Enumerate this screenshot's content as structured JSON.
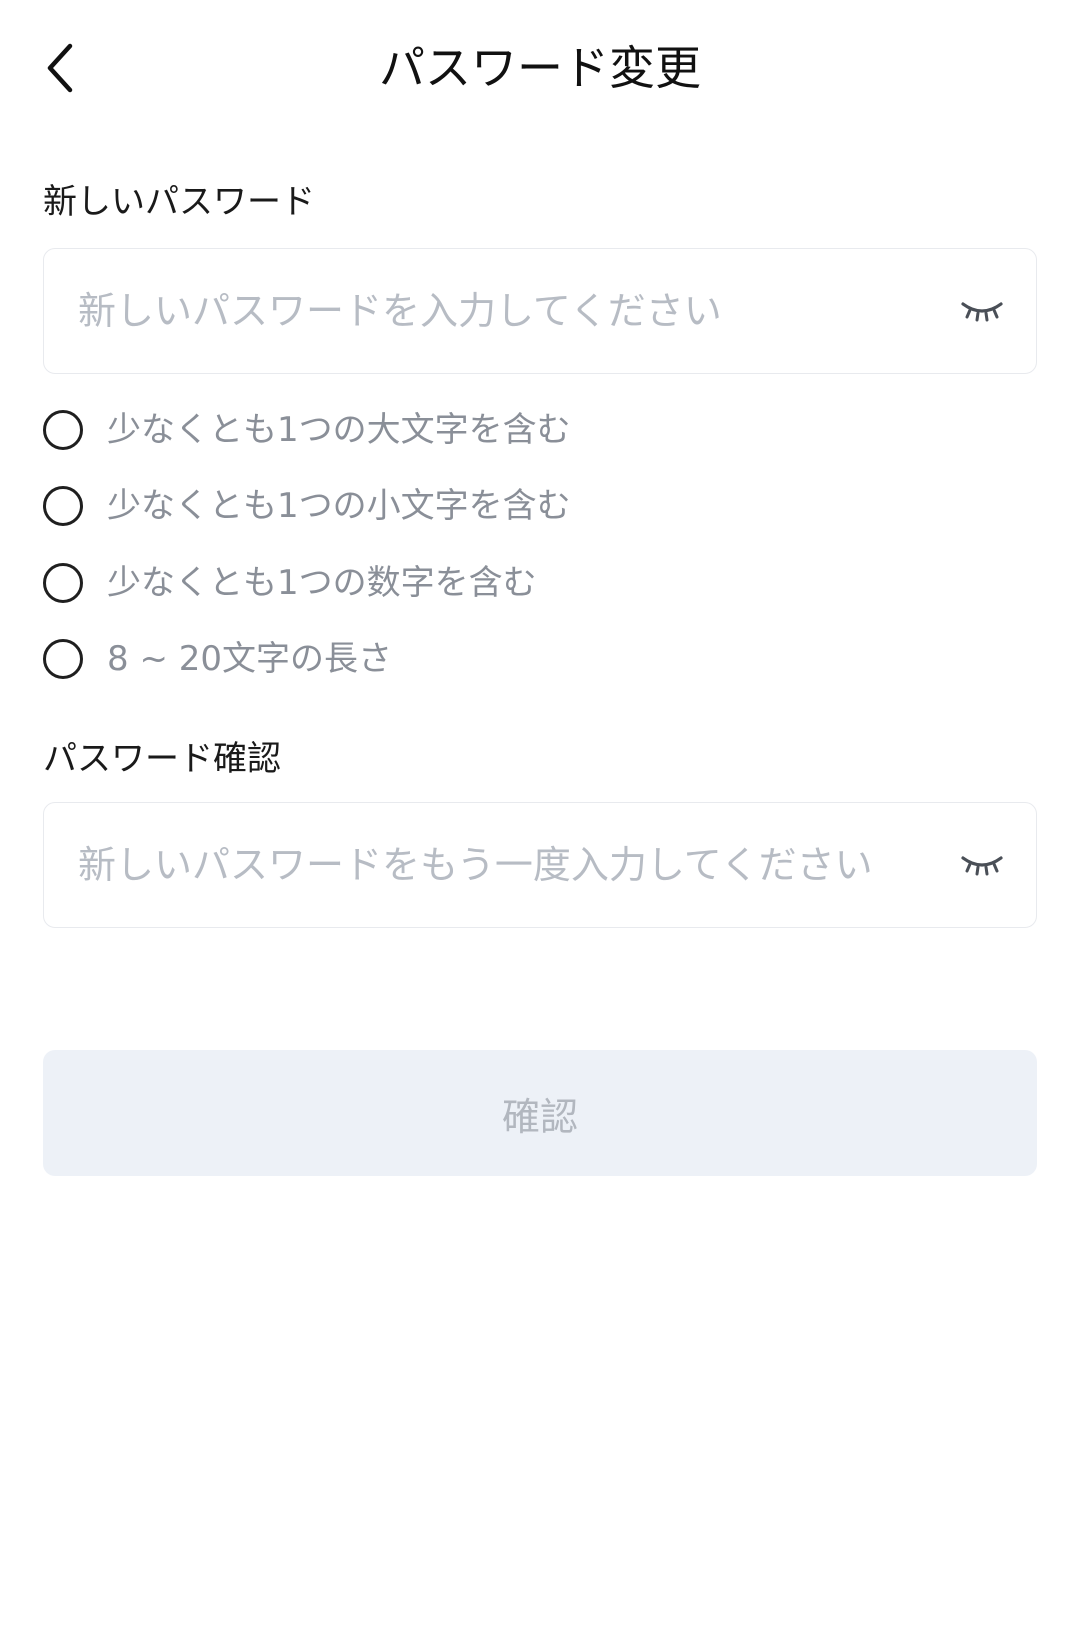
{
  "header": {
    "title": "パスワード変更"
  },
  "new_password": {
    "label": "新しいパスワード",
    "placeholder": "新しいパスワードを入力してください"
  },
  "rules": [
    {
      "text": "少なくとも1つの大文字を含む"
    },
    {
      "text": "少なくとも1つの小文字を含む"
    },
    {
      "text": "少なくとも1つの数字を含む"
    },
    {
      "text": "8 ~ 20文字の長さ"
    }
  ],
  "confirm_password": {
    "label": "パスワード確認",
    "placeholder": "新しいパスワードをもう一度入力してください"
  },
  "submit": {
    "label": "確認"
  },
  "colors": {
    "placeholder": "#b7bcc4",
    "rule_text": "#8a8f98",
    "button_bg": "#edf1f7",
    "button_text": "#b2b7bf"
  },
  "icons": {
    "back": "chevron-left-icon",
    "visibility": "eye-closed-icon"
  }
}
